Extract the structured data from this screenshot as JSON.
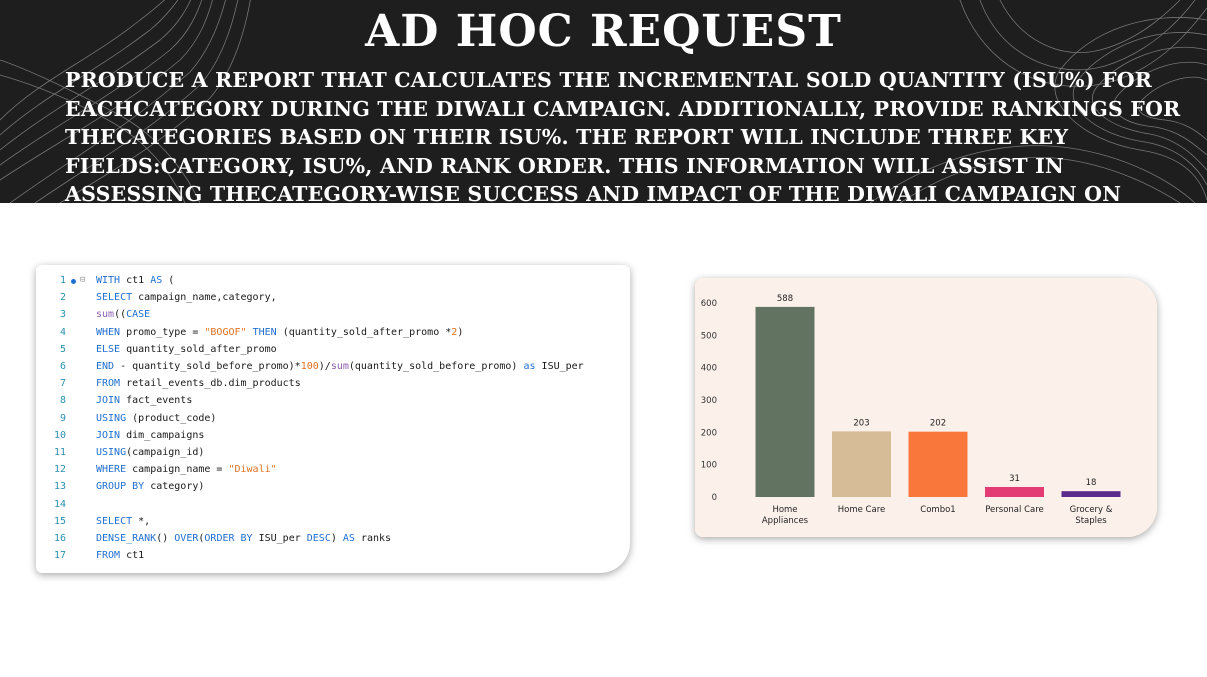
{
  "header": {
    "title": "AD HOC REQUEST",
    "description": "Produce a report that calculates the Incremental Sold Quantity (ISU%) for eachcategory during the Diwali campaign. Additionally, provide rankings for thecategories based on their ISU%. The report will include three key fields:category, isu%, and rank order. This information will assist in assessing thecategory-wise success and impact of the Diwali campaign on incremental sales."
  },
  "code": {
    "lines": [
      {
        "n": "1",
        "html": "<span class='kw'>WITH</span> ct1 <span class='kw'>AS</span> ("
      },
      {
        "n": "2",
        "html": "<span class='kw'>SELECT</span> campaign_name,category,"
      },
      {
        "n": "3",
        "html": "<span class='fn'>sum</span>((<span class='kw'>CASE</span>"
      },
      {
        "n": "4",
        "html": "<span class='kw'>WHEN</span> promo_type = <span class='str'>\"BOGOF\"</span> <span class='kw'>THEN</span> (quantity_sold_after_promo *<span class='num'>2</span>)"
      },
      {
        "n": "5",
        "html": "<span class='kw'>ELSE</span> quantity_sold_after_promo"
      },
      {
        "n": "6",
        "html": "<span class='kw'>END</span> - quantity_sold_before_promo)*<span class='num'>100</span>)/<span class='fn'>sum</span>(quantity_sold_before_promo) <span class='kw'>as</span> ISU_per"
      },
      {
        "n": "7",
        "html": "<span class='kw'>FROM</span> retail_events_db.dim_products"
      },
      {
        "n": "8",
        "html": "<span class='kw'>JOIN</span> fact_events"
      },
      {
        "n": "9",
        "html": "<span class='kw'>USING</span> (product_code)"
      },
      {
        "n": "10",
        "html": "<span class='kw'>JOIN</span> dim_campaigns"
      },
      {
        "n": "11",
        "html": "<span class='kw'>USING</span>(campaign_id)"
      },
      {
        "n": "12",
        "html": "<span class='kw'>WHERE</span> campaign_name = <span class='str'>\"Diwali\"</span>"
      },
      {
        "n": "13",
        "html": "<span class='kw'>GROUP BY</span> category)"
      },
      {
        "n": "14",
        "html": ""
      },
      {
        "n": "15",
        "html": "<span class='kw'>SELECT</span> *,"
      },
      {
        "n": "16",
        "html": "<span class='kw'>DENSE_RANK</span>() <span class='kw'>OVER</span>(<span class='kw'>ORDER BY</span> ISU_per <span class='kw'>DESC</span>) <span class='kw'>AS</span> ranks"
      },
      {
        "n": "17",
        "html": "<span class='kw'>FROM</span> ct1"
      }
    ]
  },
  "chart_data": {
    "type": "bar",
    "categories": [
      "Home Appliances",
      "Home Care",
      "Combo1",
      "Personal Care",
      "Grocery & Staples"
    ],
    "category_lines": [
      [
        "Home",
        "Appliances"
      ],
      [
        "Home Care"
      ],
      [
        "Combo1"
      ],
      [
        "Personal Care"
      ],
      [
        "Grocery &",
        "Staples"
      ]
    ],
    "values": [
      588,
      203,
      202,
      31,
      18
    ],
    "data_labels": [
      "588",
      "203",
      "202",
      "31",
      "18"
    ],
    "colors": [
      "#627461",
      "#d6bd98",
      "#f9773a",
      "#e33b74",
      "#5b2a8c"
    ],
    "yticks": [
      "0",
      "100",
      "200",
      "300",
      "400",
      "500",
      "600"
    ],
    "ylim": [
      0,
      600
    ],
    "background": "#fcf1ea",
    "title": "",
    "xlabel": "",
    "ylabel": ""
  }
}
